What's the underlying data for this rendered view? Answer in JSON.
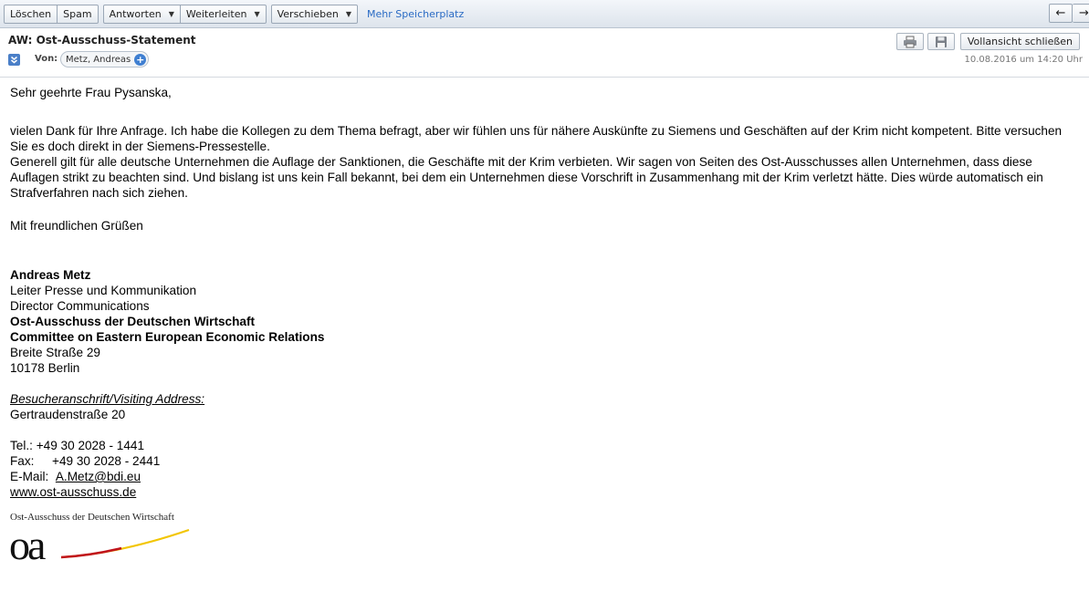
{
  "toolbar": {
    "delete_label": "Löschen",
    "spam_label": "Spam",
    "reply_label": "Antworten",
    "forward_label": "Weiterleiten",
    "move_label": "Verschieben",
    "storage_link": "Mehr Speicherplatz"
  },
  "header": {
    "subject": "AW: Ost-Ausschuss-Statement",
    "from_label": "Von:",
    "sender": "Metz, Andreas",
    "date": "10.08.2016 um 14:20 Uhr",
    "close_view_label": "Vollansicht schließen"
  },
  "body": {
    "greeting": "Sehr geehrte Frau Pysanska,",
    "para1": "vielen Dank für Ihre Anfrage. Ich habe die Kollegen zu dem Thema befragt, aber wir fühlen uns für nähere Auskünfte zu Siemens und Geschäften auf der Krim nicht kompetent. Bitte versuchen Sie es doch direkt in der Siemens-Pressestelle.",
    "para2": "Generell gilt für alle deutsche Unternehmen die Auflage der Sanktionen, die Geschäfte mit der Krim verbieten. Wir sagen von Seiten des Ost-Ausschusses allen Unternehmen, dass diese Auflagen strikt zu beachten sind. Und bislang ist uns kein Fall bekannt, bei dem ein Unternehmen diese Vorschrift in Zusammenhang mit der Krim verletzt hätte. Dies würde automatisch ein Strafverfahren nach sich ziehen.",
    "closing": "Mit freundlichen Grüßen"
  },
  "signature": {
    "name": "Andreas Metz",
    "title1": "Leiter Presse und Kommunikation",
    "title2": "Director Communications",
    "org_de": "Ost-Ausschuss der Deutschen Wirtschaft",
    "org_en": "Committee on Eastern European Economic Relations",
    "street": "Breite Straße 29",
    "city": "10178 Berlin",
    "visiting_label": "Besucheranschrift/Visiting Address:",
    "visiting_street": "Gertraudenstraße 20",
    "tel": "Tel.: +49 30 2028 - 1441",
    "fax_label": "Fax:",
    "fax_number": "+49 30 2028 - 2441",
    "email_label": "E-Mail:",
    "email": "A.Metz@bdi.eu",
    "website": "www.ost-ausschuss.de",
    "logo_caption": "Ost-Ausschuss der Deutschen Wirtschaft",
    "logo_mark": "oa"
  },
  "colors": {
    "toolbar_link": "#2a6bc4",
    "logo_red": "#c0141b",
    "logo_yellow": "#f2c500"
  }
}
